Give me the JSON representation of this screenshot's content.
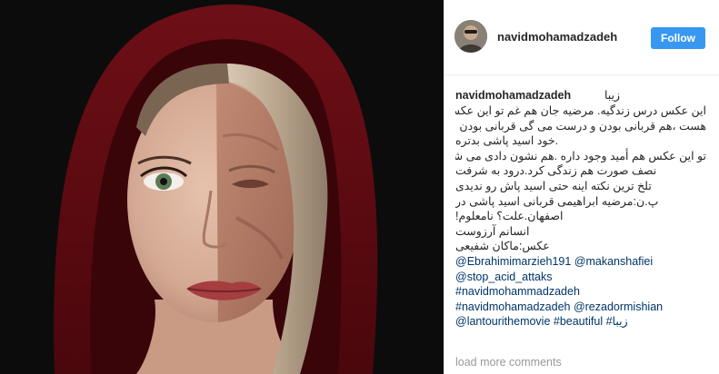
{
  "post": {
    "username": "navidmohamadzadeh",
    "follow_label": "Follow",
    "colors": {
      "follow_bg": "#3897f0",
      "link": "#003569",
      "muted": "#999999"
    }
  },
  "caption": {
    "username": "navidmohamadzadeh",
    "first_word": "زیبا",
    "lines": [
      "این عکس درس زندگیه. مرضیه جان هم غم تو این عکس",
      "هست ،هم قربانی بودن و درست می گی قربانی بودن از",
      ".خود اسید پاشی بدتره",
      "تو این عکس هم أمید وجود داره .هم نشون دادی می شه با",
      "نصف صورت هم زندگی کرد.درود به شرفت",
      "تلخ ترین نکته اینه حتی اسید پاش رو ندیدی",
      "پ.ن:مرضیه ابراهیمی قربانی اسید پاشی در",
      "اصفهان.علت؟ نامعلوم!",
      "انسانم آرزوست",
      "عکس:ماکان شفیعی"
    ],
    "tag_lines": [
      "@Ebrahimimarzieh191 @makanshafiei",
      "@stop_acid_attaks",
      "#navidmohammadzadeh",
      "#navidmohamadzadeh @rezadormishian",
      "@lantourithemovie #beautiful #زیبا"
    ]
  },
  "load_more_label": "load more comments"
}
